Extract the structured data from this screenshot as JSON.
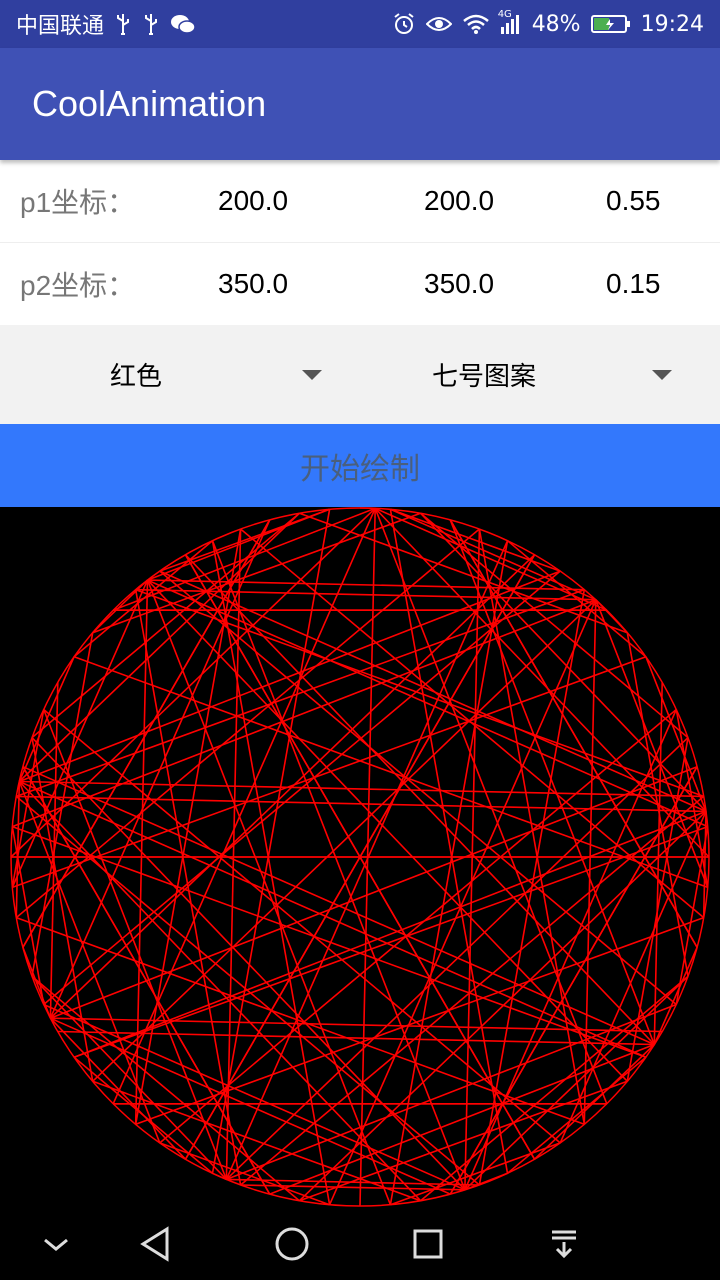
{
  "status_bar": {
    "carrier": "中国联通",
    "network": "4G",
    "battery": "48%",
    "time": "19:24",
    "icons_left": [
      "usb-icon",
      "usb-icon",
      "wechat-icon"
    ],
    "icons_right": [
      "alarm-icon",
      "eye-icon",
      "wifi-icon",
      "signal-icon",
      "battery-icon"
    ]
  },
  "app_bar": {
    "title": "CoolAnimation"
  },
  "p1": {
    "label": "p1坐标：",
    "x": "200.0",
    "y": "200.0",
    "z": "0.55"
  },
  "p2": {
    "label": "p2坐标：",
    "x": "350.0",
    "y": "350.0",
    "z": "0.15"
  },
  "color_spinner": {
    "selected": "红色"
  },
  "pattern_spinner": {
    "selected": "七号图案"
  },
  "draw_button": {
    "label": "开始绘制"
  },
  "pattern": {
    "color": "#ff0000",
    "points": 72,
    "multiplier": 7
  },
  "nav_bar": {
    "buttons": [
      "chevron-down-icon",
      "back-icon",
      "home-icon",
      "recents-icon",
      "notification-pull-icon"
    ]
  }
}
